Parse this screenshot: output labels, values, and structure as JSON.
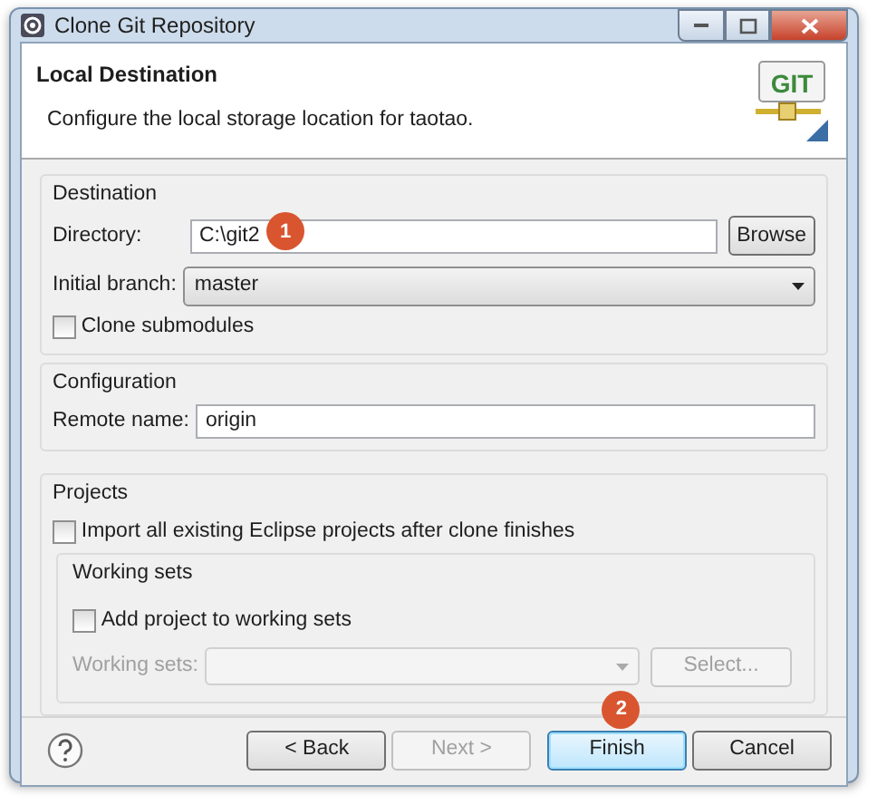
{
  "window": {
    "title": "Clone Git Repository"
  },
  "header": {
    "title": "Local Destination",
    "description": "Configure the local storage location for taotao.",
    "logo_text": "GIT"
  },
  "destination": {
    "title": "Destination",
    "directory": {
      "label": "Directory:",
      "value": "C:\\git2",
      "annotation": "1",
      "button": "Browse"
    },
    "initial_branch": {
      "label": "Initial branch:",
      "value": "master"
    },
    "clone_submodules": {
      "label": "Clone submodules",
      "checked": false
    }
  },
  "configuration": {
    "title": "Configuration",
    "remote_name": {
      "label": "Remote name:",
      "value": "origin"
    }
  },
  "projects": {
    "title": "Projects",
    "import_projects": {
      "label": "Import all existing Eclipse projects after clone finishes",
      "checked": false
    },
    "working_sets": {
      "title": "Working sets",
      "add_to_working_sets": {
        "label": "Add project to working sets",
        "checked": false
      },
      "field": {
        "label": "Working sets:",
        "disabled": true
      },
      "select_button": {
        "label": "Select...",
        "disabled": true
      }
    }
  },
  "buttons": [
    {
      "label": "< Back",
      "disabled": false,
      "default": false
    },
    {
      "label": "Next >",
      "disabled": true,
      "default": false
    },
    {
      "label": "Finish",
      "disabled": false,
      "default": true,
      "annotation": "2"
    },
    {
      "label": "Cancel",
      "disabled": false,
      "default": false
    }
  ]
}
